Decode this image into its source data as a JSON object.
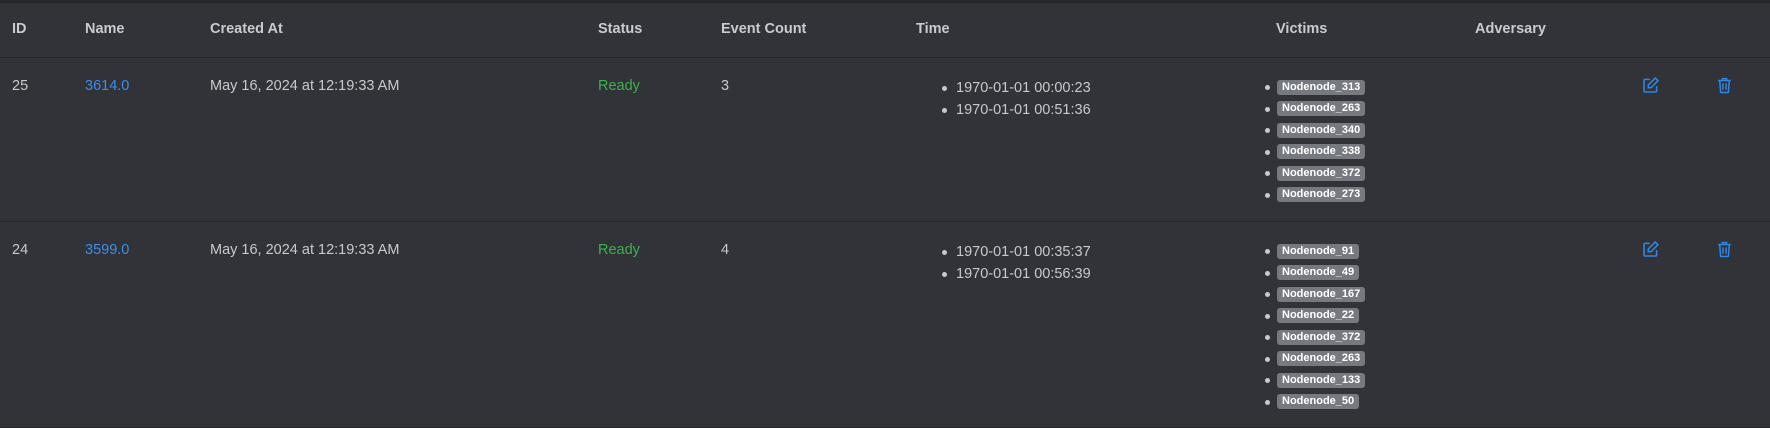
{
  "columns": {
    "id": "ID",
    "name": "Name",
    "created_at": "Created At",
    "status": "Status",
    "event_count": "Event Count",
    "time": "Time",
    "victims": "Victims",
    "adversary": "Adversary"
  },
  "rows": [
    {
      "id": "25",
      "name": "3614.0",
      "created_at": "May 16, 2024 at 12:19:33 AM",
      "status": "Ready",
      "event_count": "3",
      "times": [
        "1970-01-01 00:00:23",
        "1970-01-01 00:51:36"
      ],
      "victims": [
        "Nodenode_313",
        "Nodenode_263",
        "Nodenode_340",
        "Nodenode_338",
        "Nodenode_372",
        "Nodenode_273"
      ],
      "adversary": ""
    },
    {
      "id": "24",
      "name": "3599.0",
      "created_at": "May 16, 2024 at 12:19:33 AM",
      "status": "Ready",
      "event_count": "4",
      "times": [
        "1970-01-01 00:35:37",
        "1970-01-01 00:56:39"
      ],
      "victims": [
        "Nodenode_91",
        "Nodenode_49",
        "Nodenode_167",
        "Nodenode_22",
        "Nodenode_372",
        "Nodenode_263",
        "Nodenode_133",
        "Nodenode_50"
      ],
      "adversary": ""
    }
  ],
  "icons": {
    "edit": "edit-icon",
    "delete": "trash-icon"
  },
  "colors": {
    "background": "#323338",
    "link": "#3b8eea",
    "status_ready": "#3cb04c",
    "badge": "#767a80",
    "action_icon": "#2f86e6"
  }
}
